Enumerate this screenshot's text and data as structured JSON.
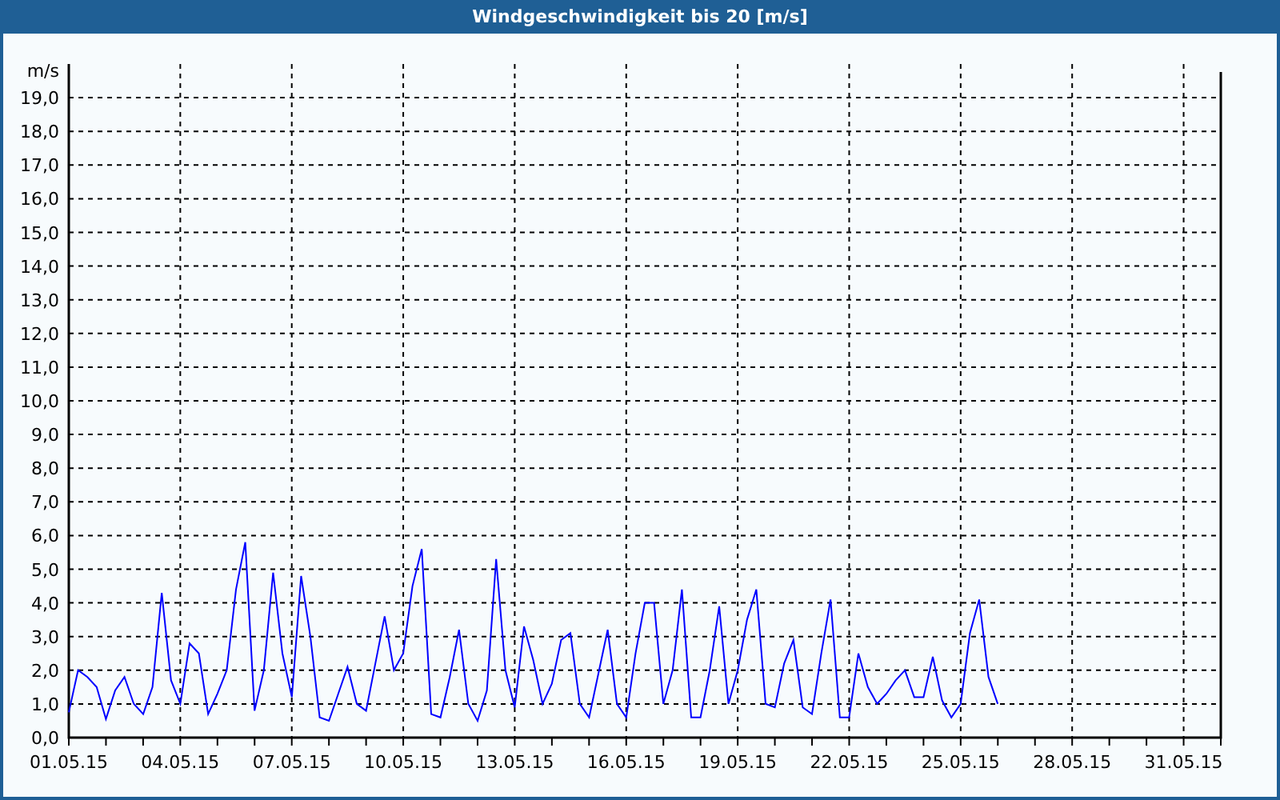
{
  "window": {
    "title": "Windgeschwindigkeit bis 20 [m/s]"
  },
  "chart_data": {
    "type": "line",
    "grid": true,
    "ylabel": "m/s",
    "ylim": [
      0,
      20
    ],
    "yticks": [
      {
        "value": 0,
        "label": "0,0"
      },
      {
        "value": 1,
        "label": "1,0"
      },
      {
        "value": 2,
        "label": "2,0"
      },
      {
        "value": 3,
        "label": "3,0"
      },
      {
        "value": 4,
        "label": "4,0"
      },
      {
        "value": 5,
        "label": "5,0"
      },
      {
        "value": 6,
        "label": "6,0"
      },
      {
        "value": 7,
        "label": "7,0"
      },
      {
        "value": 8,
        "label": "8,0"
      },
      {
        "value": 9,
        "label": "9,0"
      },
      {
        "value": 10,
        "label": "10,0"
      },
      {
        "value": 11,
        "label": "11,0"
      },
      {
        "value": 12,
        "label": "12,0"
      },
      {
        "value": 13,
        "label": "13,0"
      },
      {
        "value": 14,
        "label": "14,0"
      },
      {
        "value": 15,
        "label": "15,0"
      },
      {
        "value": 16,
        "label": "16,0"
      },
      {
        "value": 17,
        "label": "17,0"
      },
      {
        "value": 18,
        "label": "18,0"
      },
      {
        "value": 19,
        "label": "19,0"
      }
    ],
    "categories": [
      "01.05.15",
      null,
      null,
      null,
      null,
      null,
      null,
      null,
      null,
      null,
      null,
      null,
      "04.05.15",
      null,
      null,
      null,
      null,
      null,
      null,
      null,
      null,
      null,
      null,
      null,
      "07.05.15",
      null,
      null,
      null,
      null,
      null,
      null,
      null,
      null,
      null,
      null,
      null,
      "10.05.15",
      null,
      null,
      null,
      null,
      null,
      null,
      null,
      null,
      null,
      null,
      null,
      "13.05.15",
      null,
      null,
      null,
      null,
      null,
      null,
      null,
      null,
      null,
      null,
      null,
      "16.05.15",
      null,
      null,
      null,
      null,
      null,
      null,
      null,
      null,
      null,
      null,
      null,
      "19.05.15",
      null,
      null,
      null,
      null,
      null,
      null,
      null,
      null,
      null,
      null,
      null,
      "22.05.15",
      null,
      null,
      null,
      null,
      null,
      null,
      null,
      null,
      null,
      null,
      null,
      "25.05.15",
      null,
      null,
      null,
      null,
      null,
      null,
      null,
      null,
      null,
      null,
      null,
      "28.05.15",
      null,
      null,
      null,
      null,
      null,
      null,
      null,
      null,
      null,
      null,
      null,
      "31.05.15",
      null,
      null,
      null
    ],
    "series": [
      {
        "color": "#0000ff",
        "values": [
          0.75,
          2.0,
          1.8,
          1.5,
          0.55,
          1.4,
          1.8,
          1.0,
          0.7,
          1.5,
          4.3,
          1.7,
          1.0,
          2.8,
          2.5,
          0.7,
          1.3,
          2.0,
          4.4,
          5.8,
          0.8,
          2.0,
          4.9,
          2.5,
          1.2,
          4.8,
          3.0,
          0.6,
          0.5,
          1.3,
          2.1,
          1.0,
          0.8,
          2.2,
          3.6,
          2.0,
          2.5,
          4.5,
          5.6,
          0.7,
          0.6,
          1.8,
          3.2,
          1.0,
          0.5,
          1.4,
          5.3,
          2.0,
          0.9,
          3.3,
          2.3,
          1.0,
          1.6,
          2.9,
          3.1,
          1.0,
          0.6,
          1.9,
          3.2,
          1.0,
          0.6,
          2.5,
          4.0,
          4.0,
          1.0,
          2.0,
          4.4,
          0.6,
          0.6,
          2.0,
          3.9,
          1.0,
          2.0,
          3.5,
          4.4,
          1.0,
          0.9,
          2.2,
          2.9,
          0.9,
          0.7,
          2.5,
          4.1,
          0.6,
          0.6,
          2.5,
          1.5,
          1.0,
          1.3,
          1.7,
          2.0,
          1.2,
          1.2,
          2.4,
          1.1,
          0.6,
          1.0,
          3.1,
          4.1,
          1.8,
          1.0,
          null,
          null,
          null,
          null,
          null,
          null,
          null,
          null,
          null,
          null,
          null,
          null,
          null,
          null,
          null,
          null,
          null,
          null,
          null,
          null,
          null,
          null,
          null
        ]
      }
    ]
  }
}
